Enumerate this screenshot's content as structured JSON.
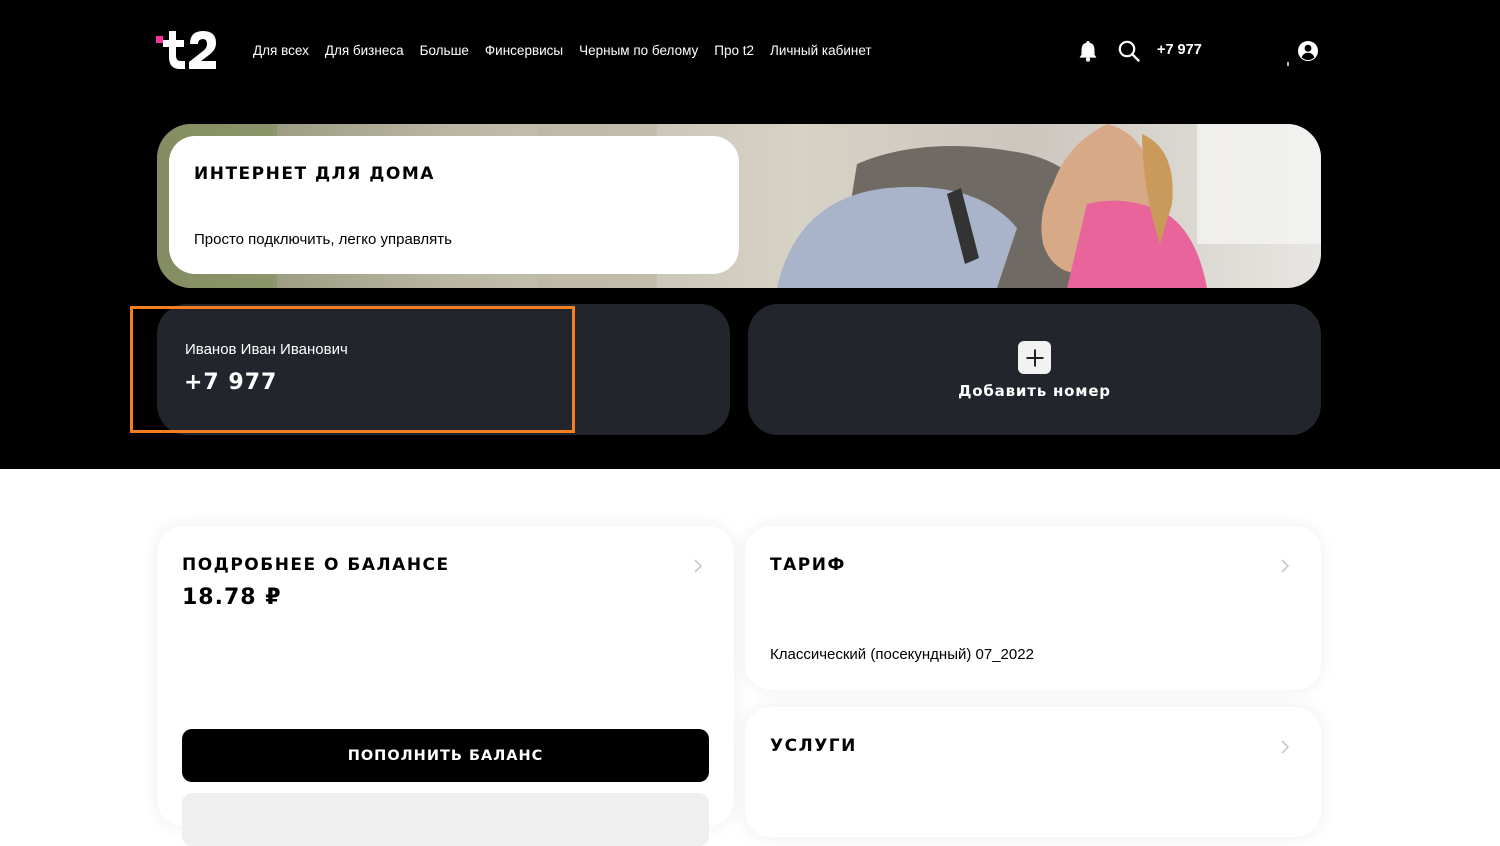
{
  "header": {
    "nav": [
      "Для всех",
      "Для бизнеса",
      "Больше",
      "Финсервисы",
      "Черным по белому",
      "Про t2",
      "Личный кабинет"
    ],
    "phone": "+7 977"
  },
  "banner": {
    "title": "ИНТЕРНЕТ ДЛЯ ДОМА",
    "subtitle": "Просто подключить, легко управлять"
  },
  "account": {
    "name": "Иванов Иван Иванович",
    "phone": "+7 977"
  },
  "add_number": {
    "label": "Добавить номер"
  },
  "balance": {
    "title": "ПОДРОБНЕЕ О БАЛАНСЕ",
    "amount": "18.78 ₽",
    "topup_label": "ПОПОЛНИТЬ БАЛАНС"
  },
  "tariff": {
    "title": "ТАРИФ",
    "name": "Классический (посекундный) 07_2022"
  },
  "services": {
    "title": "УСЛУГИ"
  },
  "colors": {
    "brand_pink": "#ff3495",
    "highlight": "#f47f20",
    "dark_card": "#22252c"
  }
}
